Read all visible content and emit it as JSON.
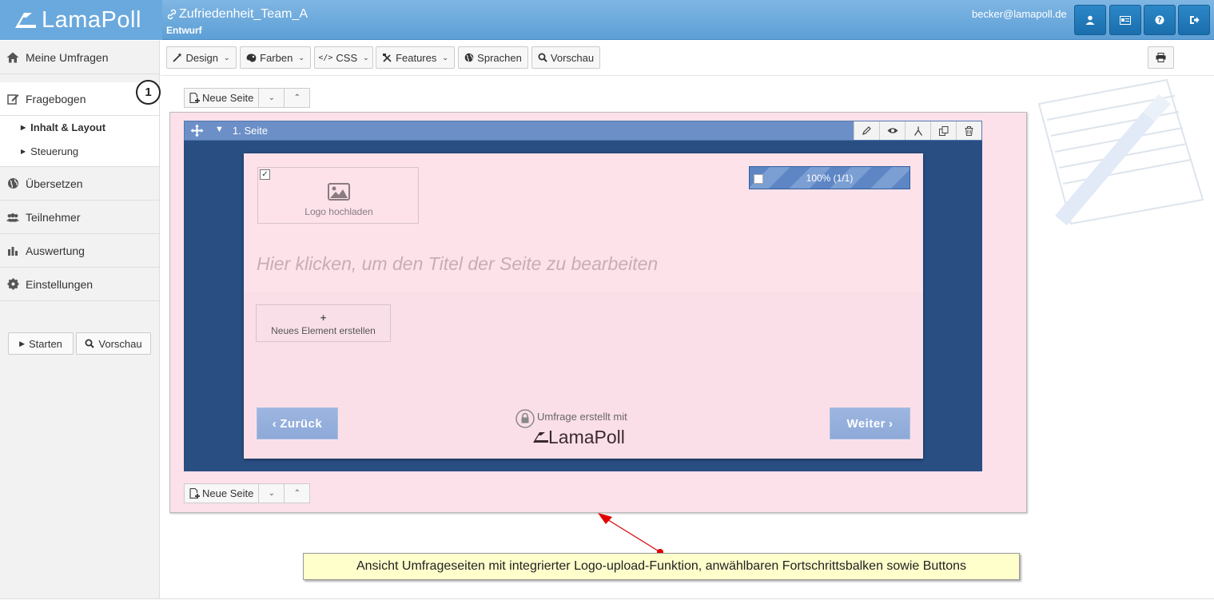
{
  "app": {
    "brand": "LamaPoll",
    "survey_title": "Zufriedenheit_Team_A",
    "survey_status": "Entwurf",
    "user_email": "becker@lamapoll.de"
  },
  "sidebar": {
    "items": [
      {
        "label": "Meine Umfragen",
        "icon": "home-icon"
      },
      {
        "label": "Fragebogen",
        "icon": "edit-icon"
      },
      {
        "label": "Übersetzen",
        "icon": "globe-icon"
      },
      {
        "label": "Teilnehmer",
        "icon": "users-icon"
      },
      {
        "label": "Auswertung",
        "icon": "bar-chart-icon"
      },
      {
        "label": "Einstellungen",
        "icon": "gear-icon"
      }
    ],
    "sub_items": [
      {
        "label": "Inhalt & Layout",
        "active": true
      },
      {
        "label": "Steuerung",
        "active": false
      }
    ],
    "step_badge": "1",
    "start_label": "Starten",
    "preview_label": "Vorschau"
  },
  "toolbar": {
    "design": "Design",
    "colors": "Farben",
    "css": "CSS",
    "features": "Features",
    "languages": "Sprachen",
    "preview": "Vorschau"
  },
  "editor": {
    "new_page_label": "Neue Seite",
    "page_heading": "1. Seite",
    "logo_upload": "Logo hochladen",
    "progress_text": "100% (1/1)",
    "title_placeholder": "Hier klicken, um den Titel der Seite zu bearbeiten",
    "new_element_plus": "+",
    "new_element_label": "Neues Element erstellen",
    "back_label": "Zurück",
    "next_label": "Weiter",
    "made_with": "Umfrage erstellt mit",
    "made_with_brand": "LamaPoll"
  },
  "annotation": {
    "text": "Ansicht Umfrageseiten mit integrierter Logo-upload-Funktion, anwählbaren Fortschrittsbalken sowie Buttons"
  },
  "colors": {
    "topbar": "#6aa9dd",
    "header_button": "#1f79b8",
    "page_frame": "#294e82",
    "page_canvas": "#fde2ea",
    "nav_button": "#95b0dc",
    "callout": "#ffffcc"
  }
}
